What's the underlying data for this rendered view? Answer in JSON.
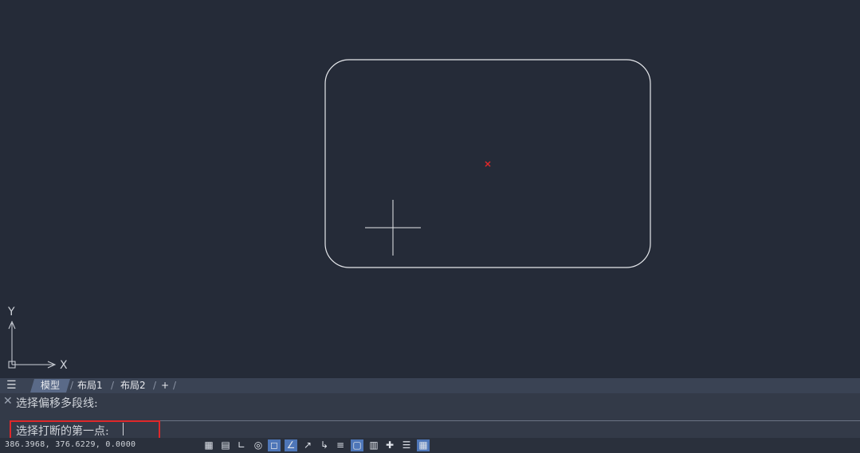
{
  "canvas": {
    "axis_y_label": "Y",
    "axis_x_label": "X",
    "colors": {
      "background": "#252b38",
      "geometry": "#e6e8ec",
      "marker": "#e0282a"
    }
  },
  "tabs": {
    "menu_icon": "hamburger-menu-icon",
    "items": [
      {
        "label": "模型",
        "active": true
      },
      {
        "label": "布局1",
        "active": false
      },
      {
        "label": "布局2",
        "active": false
      }
    ],
    "add_label": "+"
  },
  "command": {
    "history": "选择偏移多段线:",
    "prompt": "选择打断的第一点:",
    "input_value": ""
  },
  "status": {
    "coordinates": "386.3968, 376.6229, 0.0000",
    "icons": [
      {
        "name": "grid-display-icon",
        "on": false
      },
      {
        "name": "snap-mode-icon",
        "on": false
      },
      {
        "name": "ortho-mode-icon",
        "on": false
      },
      {
        "name": "polar-tracking-icon",
        "on": false
      },
      {
        "name": "object-snap-icon",
        "on": true
      },
      {
        "name": "snap-tracking-icon",
        "on": true
      },
      {
        "name": "dynamic-ucs-icon",
        "on": false
      },
      {
        "name": "dynamic-input-icon",
        "on": false
      },
      {
        "name": "lineweight-icon",
        "on": false
      },
      {
        "name": "transparency-icon",
        "on": true
      },
      {
        "name": "selection-cycling-icon",
        "on": false
      },
      {
        "name": "annotation-scale-icon",
        "on": false
      },
      {
        "name": "properties-icon",
        "on": false
      },
      {
        "name": "workspace-icon",
        "on": true
      }
    ]
  }
}
